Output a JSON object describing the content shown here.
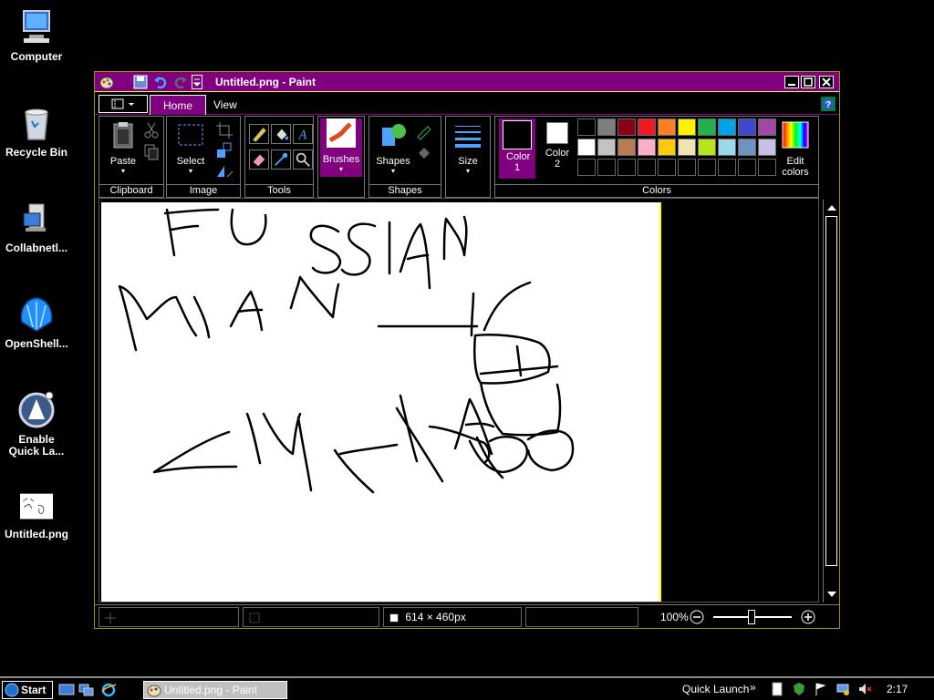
{
  "desktop": {
    "icons": [
      {
        "label": "Computer",
        "icon": "computer-icon"
      },
      {
        "label": "Recycle Bin",
        "icon": "recycle-bin-icon"
      },
      {
        "label": "Collabnetl...",
        "icon": "collabnet-icon"
      },
      {
        "label": "OpenShell...",
        "icon": "openshell-icon"
      },
      {
        "label": "Enable Quick La...",
        "icon": "quick-launch-icon"
      },
      {
        "label": "Untitled.png",
        "icon": "image-file-icon"
      }
    ]
  },
  "window": {
    "title": "Untitled.png - Paint",
    "tabs": [
      {
        "label": "Home",
        "active": true
      },
      {
        "label": "View",
        "active": false
      }
    ],
    "ribbon": {
      "clipboard": {
        "group_label": "Clipboard",
        "paste_label": "Paste"
      },
      "image": {
        "group_label": "Image",
        "select_label": "Select"
      },
      "tools": {
        "group_label": "Tools"
      },
      "brushes": {
        "label": "Brushes"
      },
      "shapes": {
        "group_label": "Shapes",
        "shapes_label": "Shapes"
      },
      "size": {
        "label": "Size"
      },
      "colors": {
        "group_label": "Colors",
        "color1_label": "Color 1",
        "color2_label": "Color 2",
        "color1_value": "#000000",
        "color2_value": "#ffffff",
        "edit_label": "Edit colors",
        "palette_row1": [
          "#000000",
          "#7f7f7f",
          "#880015",
          "#ed1c24",
          "#ff7f27",
          "#fff200",
          "#22b14c",
          "#00a2e8",
          "#3f48cc",
          "#a349a4"
        ],
        "palette_row2": [
          "#ffffff",
          "#c3c3c3",
          "#b97a57",
          "#ffaec9",
          "#ffc90e",
          "#efe4b0",
          "#b5e61d",
          "#99d9ea",
          "#7092be",
          "#c8bfe7"
        ]
      }
    },
    "status": {
      "canvas_size": "614 × 460px",
      "zoom": "100%"
    }
  },
  "taskbar": {
    "start_label": "Start",
    "task_label": "Untitled.png - Paint",
    "quick_launch_label": "Quick Launch",
    "clock": "2:17"
  },
  "colors": {
    "titlebar": "#800080",
    "accent_border": "#ffff00"
  }
}
